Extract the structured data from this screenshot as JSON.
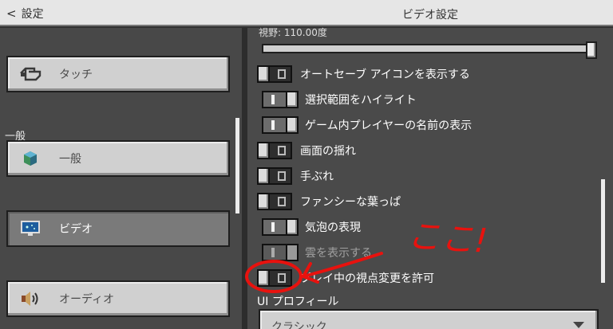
{
  "header": {
    "back_label": "設定",
    "title": "ビデオ設定"
  },
  "left_panel": {
    "section_label": "一般",
    "nav": [
      {
        "label": "タッチ",
        "icon": "touch-hand-icon",
        "active": false
      },
      {
        "label": "一般",
        "icon": "globe-cube-icon",
        "active": false
      },
      {
        "label": "ビデオ",
        "icon": "monitor-icon",
        "active": true
      },
      {
        "label": "オーディオ",
        "icon": "speaker-icon",
        "active": false
      }
    ]
  },
  "video": {
    "fov_label": "視野: 110.00度",
    "fov_value": 110,
    "options": [
      {
        "label": "オートセーブ アイコンを表示する",
        "state": "off"
      },
      {
        "label": "選択範囲をハイライト",
        "state": "on"
      },
      {
        "label": "ゲーム内プレイヤーの名前の表示",
        "state": "on"
      },
      {
        "label": "画面の揺れ",
        "state": "off"
      },
      {
        "label": "手ぶれ",
        "state": "off"
      },
      {
        "label": "ファンシーな葉っぱ",
        "state": "off"
      },
      {
        "label": "気泡の表現",
        "state": "on"
      },
      {
        "label": "雲を表示する",
        "state": "disabled"
      },
      {
        "label": "プレイ中の視点変更を許可",
        "state": "off"
      }
    ],
    "ui_profile_label": "UI プロフィール",
    "ui_profile_value": "クラシック"
  },
  "annotation": {
    "text": "ここ!",
    "color": "#e8120e"
  }
}
